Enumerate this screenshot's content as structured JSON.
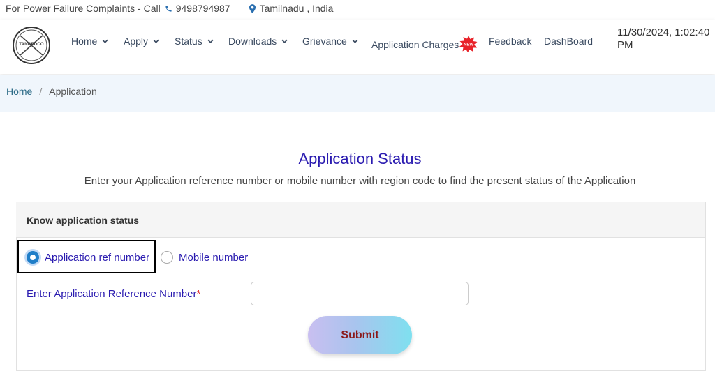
{
  "topbar": {
    "complaint_text": "For Power Failure Complaints - Call",
    "phone": "9498794987",
    "location": "Tamilnadu , India"
  },
  "logo": {
    "text": "TANGEDCO"
  },
  "nav": [
    {
      "label": "Home",
      "dropdown": true
    },
    {
      "label": "Apply",
      "dropdown": true
    },
    {
      "label": "Status",
      "dropdown": true
    },
    {
      "label": "Downloads",
      "dropdown": true
    },
    {
      "label": "Grievance",
      "dropdown": true
    },
    {
      "label": "Application Charges",
      "dropdown": false,
      "badge": "NEW"
    },
    {
      "label": "Feedback",
      "dropdown": false
    },
    {
      "label": "DashBoard",
      "dropdown": false
    }
  ],
  "datetime": "11/30/2024, 1:02:40 PM",
  "breadcrumb": {
    "home": "Home",
    "separator": "/",
    "current": "Application"
  },
  "page": {
    "title": "Application Status",
    "subtitle": "Enter your Application reference number or mobile number with region code to find the present status of the Application"
  },
  "card": {
    "title": "Know application status",
    "radios": [
      {
        "label": "Application ref number",
        "selected": true
      },
      {
        "label": "Mobile number",
        "selected": false
      }
    ],
    "field_label": "Enter Application Reference Number",
    "required_mark": "*",
    "input_value": "",
    "submit_label": "Submit"
  },
  "colors": {
    "accent": "#2a1bb0",
    "radio_selected": "#1f7ec8",
    "submit_text": "#8b1a1a",
    "badge": "#e8232a"
  }
}
